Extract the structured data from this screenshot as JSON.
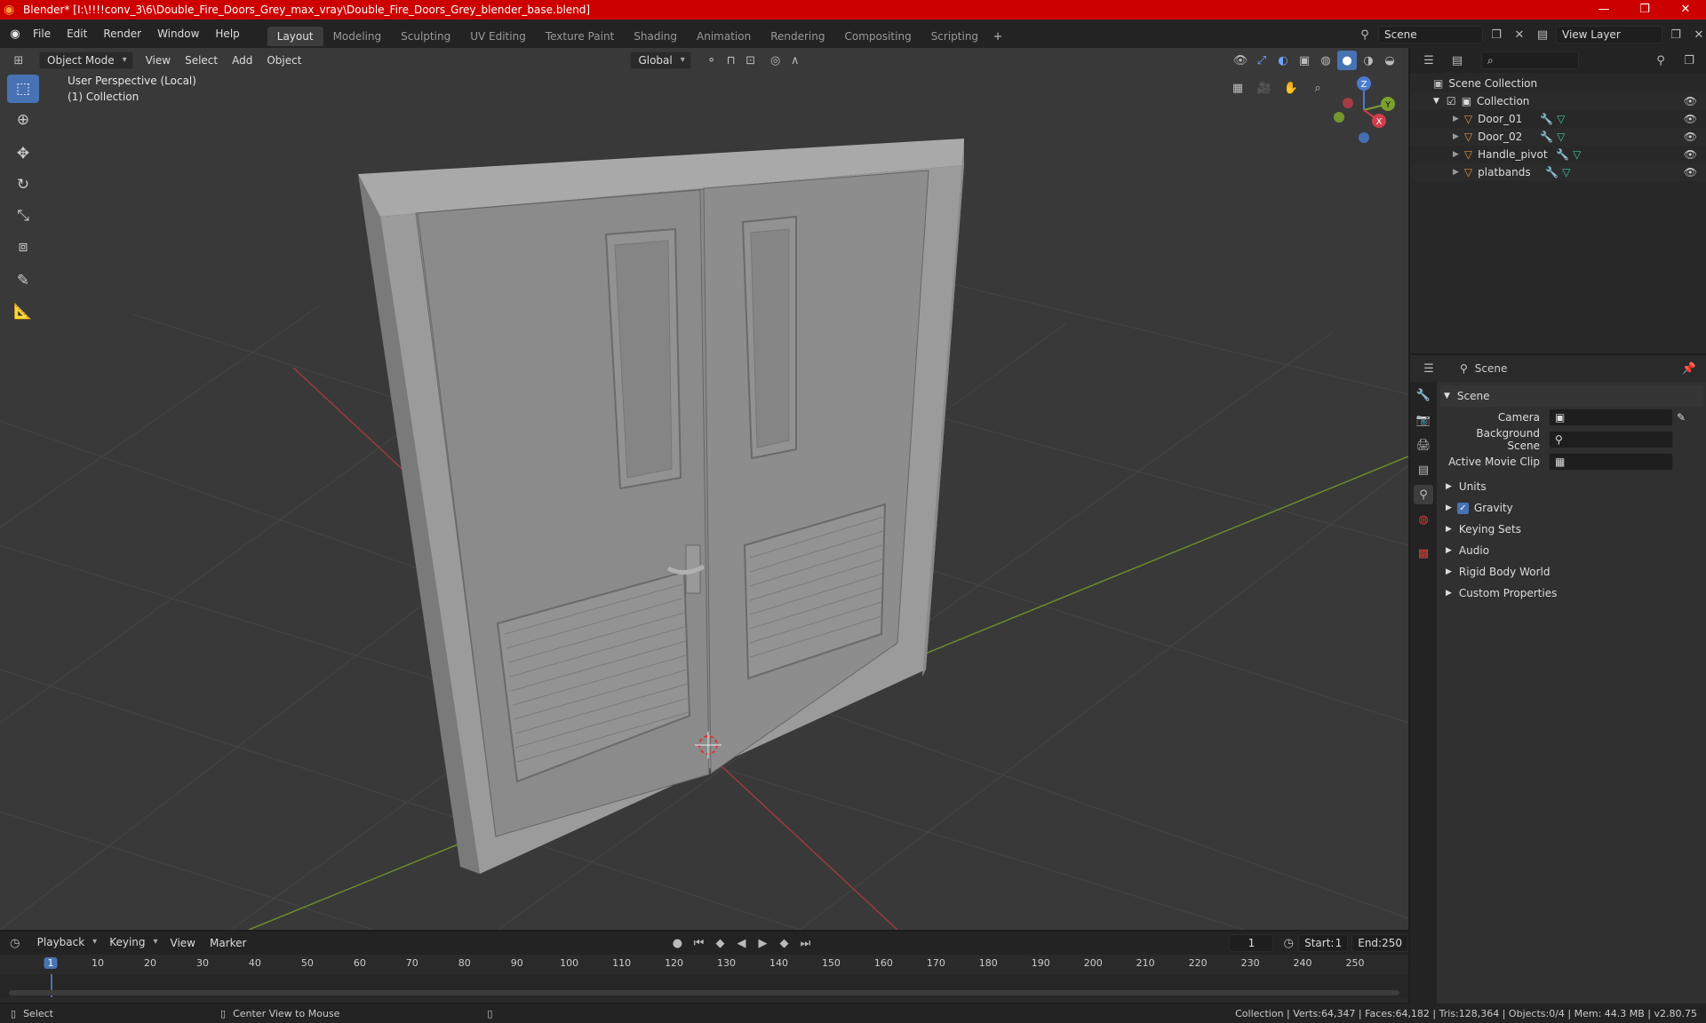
{
  "window": {
    "title": "Blender* [I:\\!!!!conv_3\\6\\Double_Fire_Doors_Grey_max_vray\\Double_Fire_Doors_Grey_blender_base.blend]",
    "controls": [
      "—",
      "❐",
      "✕"
    ]
  },
  "menu": [
    "File",
    "Edit",
    "Render",
    "Window",
    "Help"
  ],
  "workspaces": [
    "Layout",
    "Modeling",
    "Sculpting",
    "UV Editing",
    "Texture Paint",
    "Shading",
    "Animation",
    "Rendering",
    "Compositing",
    "Scripting"
  ],
  "active_workspace": "Layout",
  "scene_field": "Scene",
  "view_layer_field": "View Layer",
  "viewport": {
    "mode": "Object Mode",
    "menus": [
      "View",
      "Select",
      "Add",
      "Object"
    ],
    "transform": "Global",
    "overlay_line1": "User Perspective (Local)",
    "overlay_line2": "(1) Collection",
    "gizmo": {
      "z": "Z",
      "y": "Y",
      "x": "X"
    }
  },
  "outliner": {
    "root": "Scene Collection",
    "collection": "Collection",
    "items": [
      "Door_01",
      "Door_02",
      "Handle_pivot",
      "platbands"
    ]
  },
  "properties": {
    "header": "Scene",
    "panel": "Scene",
    "fields": [
      {
        "label": "Camera"
      },
      {
        "label": "Background Scene"
      },
      {
        "label": "Active Movie Clip"
      }
    ],
    "sections": [
      "Units",
      "Gravity",
      "Keying Sets",
      "Audio",
      "Rigid Body World",
      "Custom Properties"
    ]
  },
  "timeline": {
    "menus": [
      "Playback",
      "Keying",
      "View",
      "Marker"
    ],
    "current_frame": "1",
    "start_label": "Start:",
    "start": "1",
    "end_label": "End:",
    "end": "250",
    "ticks": [
      "1",
      "10",
      "20",
      "30",
      "40",
      "50",
      "60",
      "70",
      "80",
      "90",
      "100",
      "110",
      "120",
      "130",
      "140",
      "150",
      "160",
      "170",
      "180",
      "190",
      "200",
      "210",
      "220",
      "230",
      "240",
      "250"
    ]
  },
  "status": {
    "left1": "Select",
    "left2": "Center View to Mouse",
    "right": "Collection | Verts:64,347 | Faces:64,182 | Tris:128,364 | Objects:0/4 | Mem: 44.3 MB | v2.80.75"
  },
  "colors": {
    "titlebar": "#cc0000",
    "accent": "#4772b3",
    "viewport_bg": "#393939",
    "x_axis": "#b3343c",
    "y_axis": "#7ba12c"
  }
}
